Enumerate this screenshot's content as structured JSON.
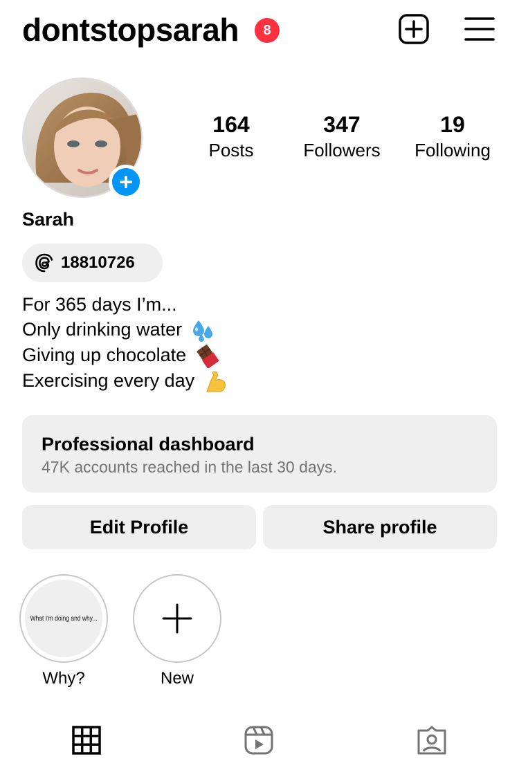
{
  "header": {
    "username": "dontstopsarah",
    "notification_count": "8",
    "new_post_icon": "plus-square-icon",
    "menu_icon": "hamburger-menu-icon"
  },
  "profile": {
    "avatar_add_icon": "plus-icon",
    "display_name": "Sarah",
    "threads_handle": "18810726",
    "stats": [
      {
        "value": "164",
        "label": "Posts"
      },
      {
        "value": "347",
        "label": "Followers"
      },
      {
        "value": "19",
        "label": "Following"
      }
    ],
    "bio_lines": [
      {
        "text": "For 365 days I’m...",
        "emoji": ""
      },
      {
        "text": "Only drinking water",
        "emoji": "sweat-droplets-icon"
      },
      {
        "text": "Giving up chocolate",
        "emoji": "chocolate-bar-icon"
      },
      {
        "text": "Exercising every day",
        "emoji": "flexed-biceps-icon"
      }
    ]
  },
  "dashboard": {
    "title": "Professional dashboard",
    "subtitle": "47K accounts reached in the last 30 days."
  },
  "actions": {
    "edit_label": "Edit Profile",
    "share_label": "Share profile"
  },
  "highlights": [
    {
      "label": "Why?",
      "cover_text": "What I'm doing and why..."
    },
    {
      "label": "New"
    }
  ],
  "tabs": [
    {
      "icon": "grid-icon"
    },
    {
      "icon": "reels-icon"
    },
    {
      "icon": "tagged-icon"
    }
  ],
  "colors": {
    "badge": "#ff3040",
    "accent_blue": "#0095f6",
    "button_bg": "#efefef",
    "muted_text": "#737373"
  }
}
